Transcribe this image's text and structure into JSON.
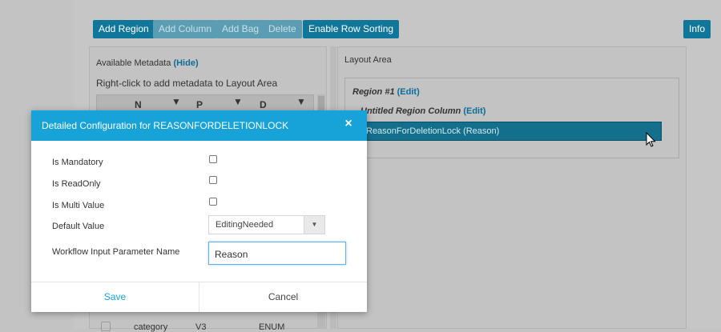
{
  "toolbar": {
    "add_region": "Add Region",
    "add_column": "Add Column",
    "add_bag": "Add Bag",
    "delete": "Delete",
    "enable_row_sorting": "Enable Row Sorting",
    "info": "Info"
  },
  "available_metadata": {
    "heading": "Available Metadata",
    "hide_link": "(Hide)",
    "hint": "Right-click to add metadata to Layout Area",
    "columns": [
      "N",
      "P",
      "D"
    ],
    "visible_row": {
      "name": "category",
      "prefix": "V3",
      "datatype": "ENUM"
    }
  },
  "layout_area": {
    "heading": "Layout Area",
    "region_title": "Region #1",
    "region_edit": "(Edit)",
    "column_title": "Untitled Region Column",
    "column_edit": "(Edit)",
    "item_label": "ReasonForDeletionLock (Reason)"
  },
  "modal": {
    "title": "Detailed Configuration for REASONFORDELETIONLOCK",
    "close_glyph": "×",
    "fields": {
      "is_mandatory": {
        "label": "Is Mandatory",
        "checked": false
      },
      "is_readonly": {
        "label": "Is ReadOnly",
        "checked": false
      },
      "is_multi_value": {
        "label": "Is Multi Value",
        "checked": false
      },
      "default_value": {
        "label": "Default Value",
        "selected": "EditingNeeded"
      },
      "workflow_input": {
        "label": "Workflow Input Parameter Name",
        "value": "Reason"
      }
    },
    "save": "Save",
    "cancel": "Cancel"
  },
  "colors": {
    "modal_header": "#17a2d8",
    "toolbar_button": "#11779a",
    "overlay": "#c3c3c3"
  }
}
